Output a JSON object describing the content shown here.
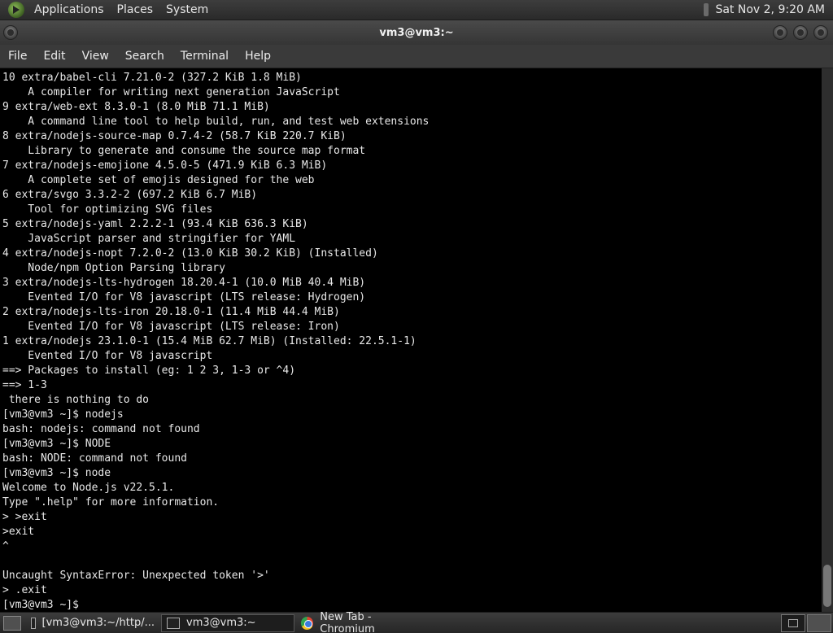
{
  "top_panel": {
    "menus": [
      "Applications",
      "Places",
      "System"
    ],
    "clock": "Sat Nov 2, 9:20 AM"
  },
  "window": {
    "title": "vm3@vm3:~"
  },
  "menu_bar": [
    "File",
    "Edit",
    "View",
    "Search",
    "Terminal",
    "Help"
  ],
  "terminal": {
    "lines": [
      "10 extra/babel-cli 7.21.0-2 (327.2 KiB 1.8 MiB)",
      "    A compiler for writing next generation JavaScript",
      "9 extra/web-ext 8.3.0-1 (8.0 MiB 71.1 MiB)",
      "    A command line tool to help build, run, and test web extensions",
      "8 extra/nodejs-source-map 0.7.4-2 (58.7 KiB 220.7 KiB)",
      "    Library to generate and consume the source map format",
      "7 extra/nodejs-emojione 4.5.0-5 (471.9 KiB 6.3 MiB)",
      "    A complete set of emojis designed for the web",
      "6 extra/svgo 3.3.2-2 (697.2 KiB 6.7 MiB)",
      "    Tool for optimizing SVG files",
      "5 extra/nodejs-yaml 2.2.2-1 (93.4 KiB 636.3 KiB)",
      "    JavaScript parser and stringifier for YAML",
      "4 extra/nodejs-nopt 7.2.0-2 (13.0 KiB 30.2 KiB) (Installed)",
      "    Node/npm Option Parsing library",
      "3 extra/nodejs-lts-hydrogen 18.20.4-1 (10.0 MiB 40.4 MiB)",
      "    Evented I/O for V8 javascript (LTS release: Hydrogen)",
      "2 extra/nodejs-lts-iron 20.18.0-1 (11.4 MiB 44.4 MiB)",
      "    Evented I/O for V8 javascript (LTS release: Iron)",
      "1 extra/nodejs 23.1.0-1 (15.4 MiB 62.7 MiB) (Installed: 22.5.1-1)",
      "    Evented I/O for V8 javascript",
      "==> Packages to install (eg: 1 2 3, 1-3 or ^4)",
      "==> 1-3",
      " there is nothing to do",
      "[vm3@vm3 ~]$ nodejs",
      "bash: nodejs: command not found",
      "[vm3@vm3 ~]$ NODE",
      "bash: NODE: command not found",
      "[vm3@vm3 ~]$ node",
      "Welcome to Node.js v22.5.1.",
      "Type \".help\" for more information.",
      "> >exit",
      ">exit",
      "^",
      "",
      "Uncaught SyntaxError: Unexpected token '>'",
      "> .exit",
      "[vm3@vm3 ~]$"
    ]
  },
  "taskbar": {
    "tasks": [
      {
        "label": "[vm3@vm3:~/http/...",
        "icon": "terminal-icon"
      },
      {
        "label": "vm3@vm3:~",
        "icon": "terminal-icon"
      },
      {
        "label": "New Tab - Chromium",
        "icon": "chromium-icon"
      }
    ]
  }
}
